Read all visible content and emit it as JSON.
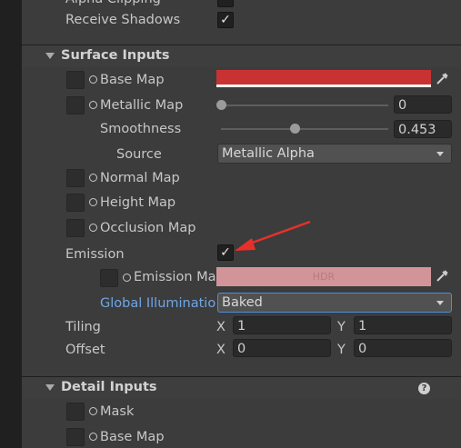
{
  "lighting": {
    "cut_label": "Alpha Clipping",
    "receive_shadows_label": "Receive Shadows",
    "receive_shadows_checked": true
  },
  "surface_inputs": {
    "title": "Surface Inputs",
    "base_map_label": "Base Map",
    "base_map_color": "#c83232",
    "metallic_map_label": "Metallic Map",
    "metallic_value": "0",
    "smoothness_label": "Smoothness",
    "smoothness_value": "0.453",
    "source_label": "Source",
    "source_value": "Metallic Alpha",
    "normal_map_label": "Normal Map",
    "height_map_label": "Height Map",
    "occlusion_map_label": "Occlusion Map",
    "emission_label": "Emission",
    "emission_checked": true,
    "emission_map_label": "Emission Map",
    "emission_hdr_text": "HDR",
    "emission_color": "#d19599",
    "gi_label": "Global Illumination",
    "gi_value": "Baked",
    "tiling_label": "Tiling",
    "tiling_x_label": "X",
    "tiling_x": "1",
    "tiling_y_label": "Y",
    "tiling_y": "1",
    "offset_label": "Offset",
    "offset_x_label": "X",
    "offset_x": "0",
    "offset_y_label": "Y",
    "offset_y": "0"
  },
  "detail_inputs": {
    "title": "Detail Inputs",
    "mask_label": "Mask",
    "base_map_label": "Base Map"
  },
  "annotation": {
    "arrow_color": "#e8302a"
  },
  "icons": [
    "expand-triangle-icon",
    "texture-slot-icon",
    "picker-dot-icon",
    "checkmark-icon",
    "eyedropper-icon",
    "help-icon",
    "dropdown-caret-icon"
  ]
}
